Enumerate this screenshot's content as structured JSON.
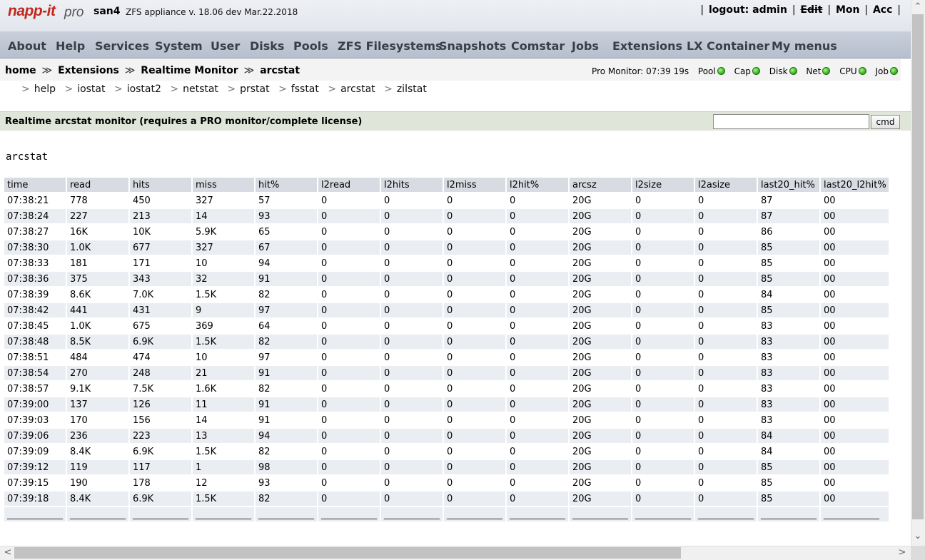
{
  "header": {
    "logo": "napp-it",
    "logo_pro": "pro",
    "hostname": "san4",
    "appliance": "ZFS appliance v. 18.06 dev Mar.22.2018",
    "logout": "logout: admin",
    "edit": "Edit",
    "mon": "Mon",
    "acc": "Acc"
  },
  "nav": [
    {
      "label": "About"
    },
    {
      "label": "Help"
    },
    {
      "label": "Services"
    },
    {
      "label": "System"
    },
    {
      "label": "User"
    },
    {
      "label": "Disks"
    },
    {
      "label": "Pools"
    },
    {
      "label": "ZFS Filesystems"
    },
    {
      "label": "Snapshots"
    },
    {
      "label": "Comstar"
    },
    {
      "label": "Jobs"
    },
    {
      "label": "Extensions"
    },
    {
      "label": "LX Container"
    },
    {
      "label": "My menus"
    }
  ],
  "breadcrumb": [
    "home",
    "Extensions",
    "Realtime Monitor",
    "arcstat"
  ],
  "breadcrumb_sep": "≫",
  "status": {
    "monitor": "Pro Monitor: 07:39 19s",
    "indicators": [
      "Pool",
      "Cap",
      "Disk",
      "Net",
      "CPU",
      "Job"
    ],
    "indicator_color": "#2fa81a"
  },
  "subnav": {
    "arrow": ">",
    "items": [
      "help",
      "iostat",
      "iostat2",
      "netstat",
      "prstat",
      "fsstat",
      "arcstat",
      "zilstat"
    ]
  },
  "section": {
    "title": "Realtime arcstat monitor (requires a PRO monitor/complete license)",
    "cmd_value": "",
    "cmd_button": "cmd"
  },
  "output_title": "arcstat",
  "table": {
    "columns": [
      "time",
      "read",
      "hits",
      "miss",
      "hit%",
      "l2read",
      "l2hits",
      "l2miss",
      "l2hit%",
      "arcsz",
      "l2size",
      "l2asize",
      "last20_hit%",
      "last20_l2hit%"
    ],
    "rows": [
      [
        "07:38:21",
        "778",
        "450",
        "327",
        "57",
        "0",
        "0",
        "0",
        "0",
        "20G",
        "0",
        "0",
        "87",
        "00"
      ],
      [
        "07:38:24",
        "227",
        "213",
        "14",
        "93",
        "0",
        "0",
        "0",
        "0",
        "20G",
        "0",
        "0",
        "87",
        "00"
      ],
      [
        "07:38:27",
        "16K",
        "10K",
        "5.9K",
        "65",
        "0",
        "0",
        "0",
        "0",
        "20G",
        "0",
        "0",
        "86",
        "00"
      ],
      [
        "07:38:30",
        "1.0K",
        "677",
        "327",
        "67",
        "0",
        "0",
        "0",
        "0",
        "20G",
        "0",
        "0",
        "85",
        "00"
      ],
      [
        "07:38:33",
        "181",
        "171",
        "10",
        "94",
        "0",
        "0",
        "0",
        "0",
        "20G",
        "0",
        "0",
        "85",
        "00"
      ],
      [
        "07:38:36",
        "375",
        "343",
        "32",
        "91",
        "0",
        "0",
        "0",
        "0",
        "20G",
        "0",
        "0",
        "85",
        "00"
      ],
      [
        "07:38:39",
        "8.6K",
        "7.0K",
        "1.5K",
        "82",
        "0",
        "0",
        "0",
        "0",
        "20G",
        "0",
        "0",
        "84",
        "00"
      ],
      [
        "07:38:42",
        "441",
        "431",
        "9",
        "97",
        "0",
        "0",
        "0",
        "0",
        "20G",
        "0",
        "0",
        "85",
        "00"
      ],
      [
        "07:38:45",
        "1.0K",
        "675",
        "369",
        "64",
        "0",
        "0",
        "0",
        "0",
        "20G",
        "0",
        "0",
        "83",
        "00"
      ],
      [
        "07:38:48",
        "8.5K",
        "6.9K",
        "1.5K",
        "82",
        "0",
        "0",
        "0",
        "0",
        "20G",
        "0",
        "0",
        "83",
        "00"
      ],
      [
        "07:38:51",
        "484",
        "474",
        "10",
        "97",
        "0",
        "0",
        "0",
        "0",
        "20G",
        "0",
        "0",
        "83",
        "00"
      ],
      [
        "07:38:54",
        "270",
        "248",
        "21",
        "91",
        "0",
        "0",
        "0",
        "0",
        "20G",
        "0",
        "0",
        "83",
        "00"
      ],
      [
        "07:38:57",
        "9.1K",
        "7.5K",
        "1.6K",
        "82",
        "0",
        "0",
        "0",
        "0",
        "20G",
        "0",
        "0",
        "83",
        "00"
      ],
      [
        "07:39:00",
        "137",
        "126",
        "11",
        "91",
        "0",
        "0",
        "0",
        "0",
        "20G",
        "0",
        "0",
        "83",
        "00"
      ],
      [
        "07:39:03",
        "170",
        "156",
        "14",
        "91",
        "0",
        "0",
        "0",
        "0",
        "20G",
        "0",
        "0",
        "83",
        "00"
      ],
      [
        "07:39:06",
        "236",
        "223",
        "13",
        "94",
        "0",
        "0",
        "0",
        "0",
        "20G",
        "0",
        "0",
        "84",
        "00"
      ],
      [
        "07:39:09",
        "8.4K",
        "6.9K",
        "1.5K",
        "82",
        "0",
        "0",
        "0",
        "0",
        "20G",
        "0",
        "0",
        "84",
        "00"
      ],
      [
        "07:39:12",
        "119",
        "117",
        "1",
        "98",
        "0",
        "0",
        "0",
        "0",
        "20G",
        "0",
        "0",
        "85",
        "00"
      ],
      [
        "07:39:15",
        "190",
        "178",
        "12",
        "93",
        "0",
        "0",
        "0",
        "0",
        "20G",
        "0",
        "0",
        "85",
        "00"
      ],
      [
        "07:39:18",
        "8.4K",
        "6.9K",
        "1.5K",
        "82",
        "0",
        "0",
        "0",
        "0",
        "20G",
        "0",
        "0",
        "85",
        "00"
      ]
    ],
    "footer_cell": "____________"
  },
  "scrollbar_arrows": {
    "up": "⌃",
    "down": "⌄",
    "left": "<",
    "right": ">"
  }
}
